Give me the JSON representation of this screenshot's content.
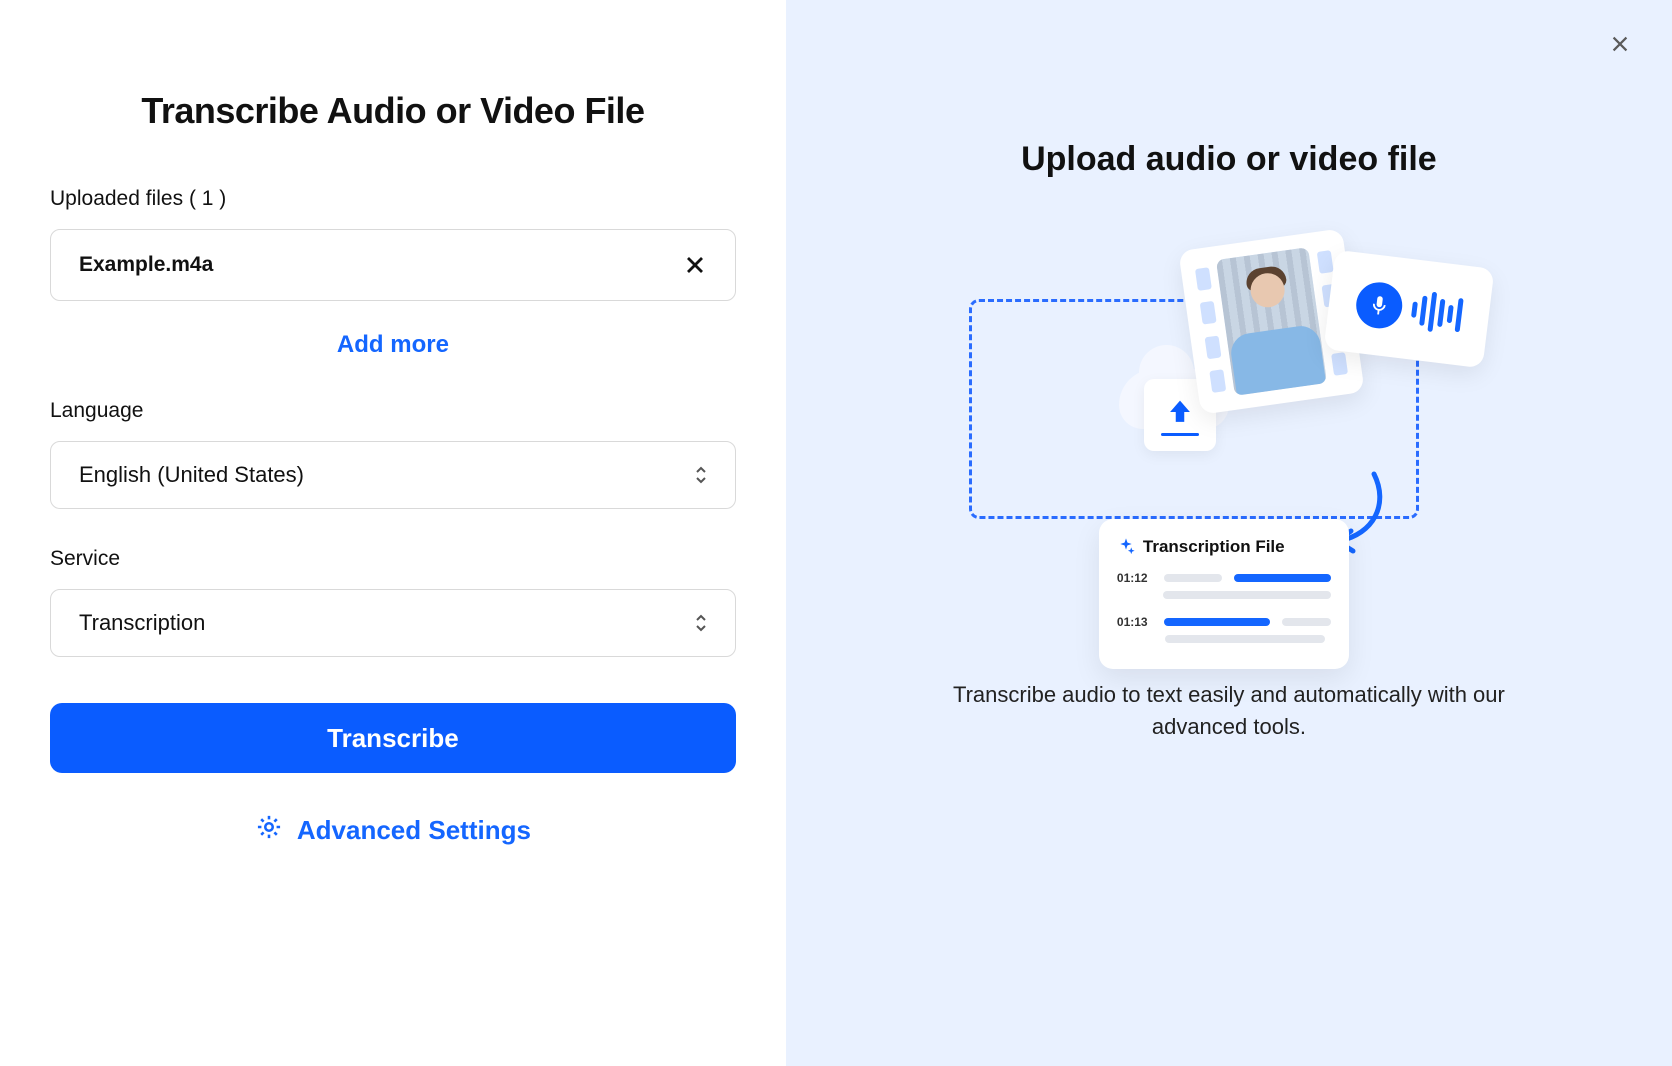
{
  "left": {
    "title": "Transcribe Audio or Video File",
    "uploaded_label_prefix": "Uploaded files",
    "uploaded_count": "( 1 )",
    "files": [
      {
        "name": "Example.m4a"
      }
    ],
    "add_more": "Add more",
    "language_label": "Language",
    "language_value": "English (United States)",
    "service_label": "Service",
    "service_value": "Transcription",
    "transcribe_button": "Transcribe",
    "advanced_settings": "Advanced Settings"
  },
  "right": {
    "title": "Upload audio or video file",
    "transcription_card_title": "Transcription File",
    "ts1": "01:12",
    "ts2": "01:13",
    "description": "Transcribe audio to text easily and automatically with our advanced tools."
  }
}
